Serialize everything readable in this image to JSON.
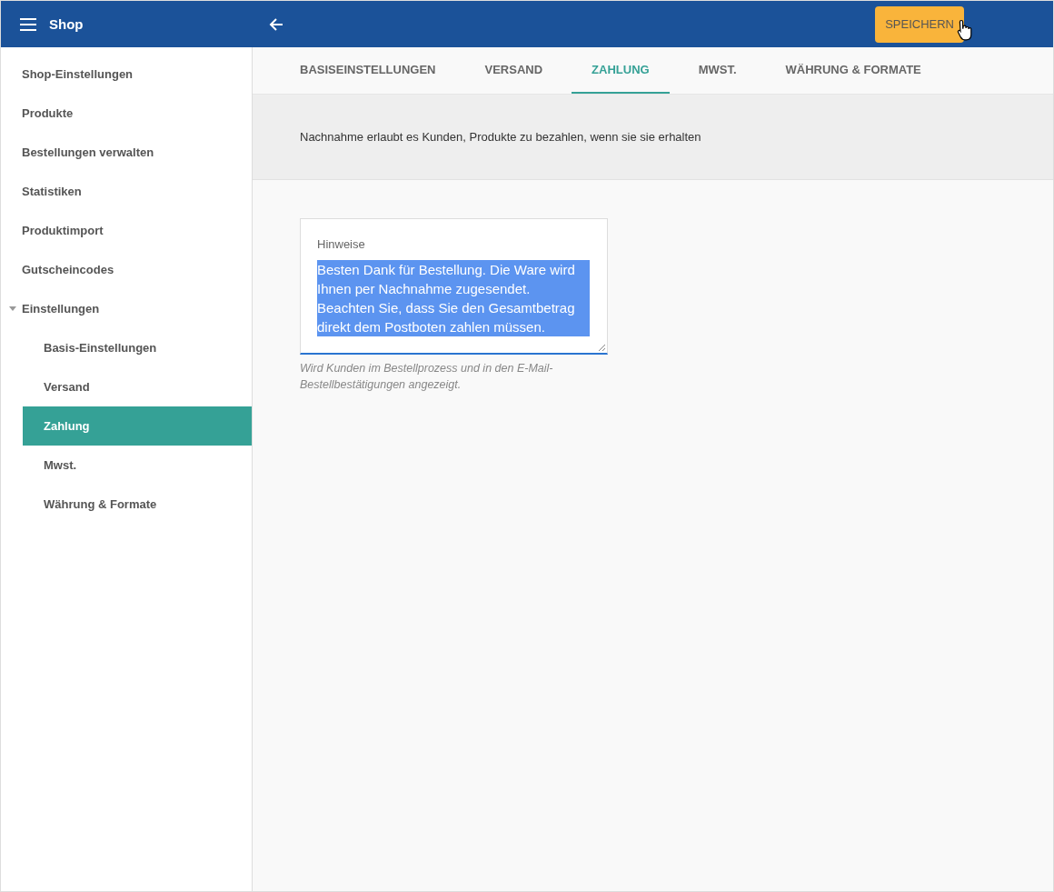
{
  "app_bar": {
    "title": "Shop",
    "save_button": "SPEICHERN"
  },
  "sidebar": {
    "items": [
      {
        "label": "Shop-Einstellungen",
        "selected": false
      },
      {
        "label": "Produkte",
        "selected": false
      },
      {
        "label": "Bestellungen verwalten",
        "selected": false
      },
      {
        "label": "Statistiken",
        "selected": false
      },
      {
        "label": "Produktimport",
        "selected": false
      },
      {
        "label": "Gutscheincodes",
        "selected": false
      },
      {
        "label": "Einstellungen",
        "selected": false,
        "expanded": true,
        "children": [
          {
            "label": "Basis-Einstellungen",
            "selected": false
          },
          {
            "label": "Versand",
            "selected": false
          },
          {
            "label": "Zahlung",
            "selected": true
          },
          {
            "label": "Mwst.",
            "selected": false
          },
          {
            "label": "Währung & Formate",
            "selected": false
          }
        ]
      }
    ]
  },
  "tabs": [
    {
      "label": "BASISEINSTELLUNGEN",
      "selected": false
    },
    {
      "label": "VERSAND",
      "selected": false
    },
    {
      "label": "ZAHLUNG",
      "selected": true
    },
    {
      "label": "MWST.",
      "selected": false
    },
    {
      "label": "WÄHRUNG & FORMATE",
      "selected": false
    }
  ],
  "info_text": "Nachnahme erlaubt es Kunden, Produkte zu bezahlen, wenn sie sie erhalten",
  "notes_field": {
    "label": "Hinweise",
    "value": "Besten Dank für Bestellung. Die Ware wird Ihnen per Nachnahme zugesendet. Beachten Sie, dass Sie den Gesamtbetrag direkt dem Postboten zahlen müssen.",
    "text_selected": true,
    "focused": true,
    "hint": "Wird Kunden im Bestellprozess und in den E-Mail-Bestellbestätigungen angezeigt."
  }
}
